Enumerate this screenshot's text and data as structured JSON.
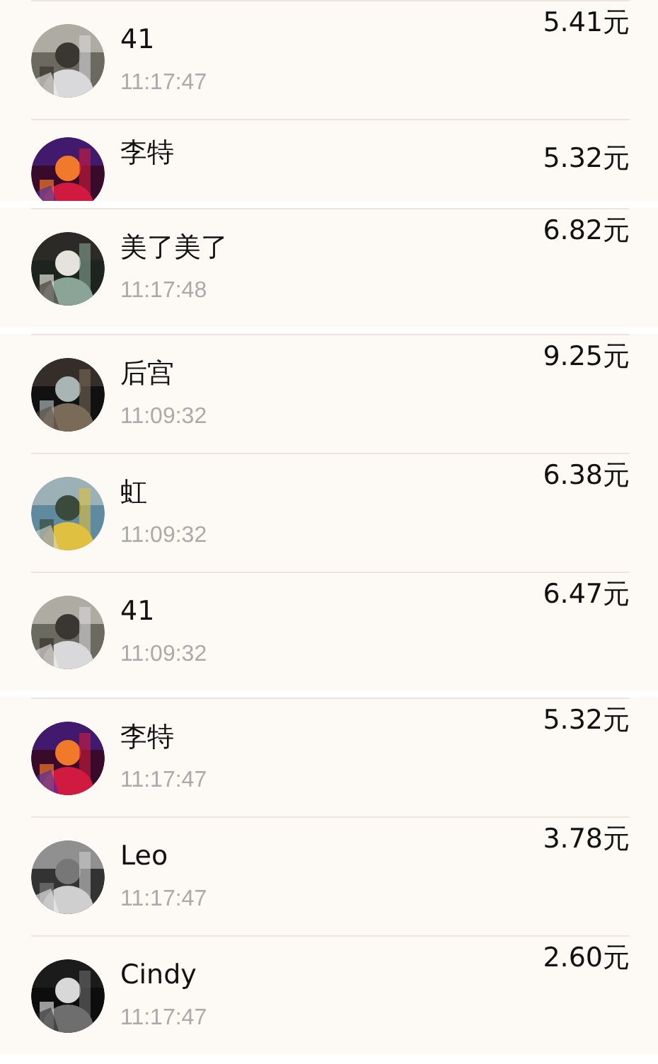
{
  "segments": [
    {
      "rows": [
        {
          "name": "41",
          "time": "11:17:47",
          "amount": "5.41元"
        },
        {
          "name": "李特",
          "amount": "5.32元"
        }
      ]
    },
    {
      "rows": [
        {
          "name": "美了美了",
          "time": "11:17:48",
          "amount": "6.82元"
        }
      ]
    },
    {
      "rows": [
        {
          "name": "后宫",
          "time": "11:09:32",
          "amount": "9.25元"
        },
        {
          "name": "虹",
          "time": "11:09:32",
          "amount": "6.38元"
        },
        {
          "name": "41",
          "time": "11:09:32",
          "amount": "6.47元"
        }
      ]
    },
    {
      "rows": [
        {
          "name": "李特",
          "time": "11:17:47",
          "amount": "5.32元"
        },
        {
          "name": "Leo",
          "time": "11:17:47",
          "amount": "3.78元"
        },
        {
          "name": "Cindy",
          "time": "11:17:47",
          "amount": "2.60元"
        }
      ]
    }
  ]
}
